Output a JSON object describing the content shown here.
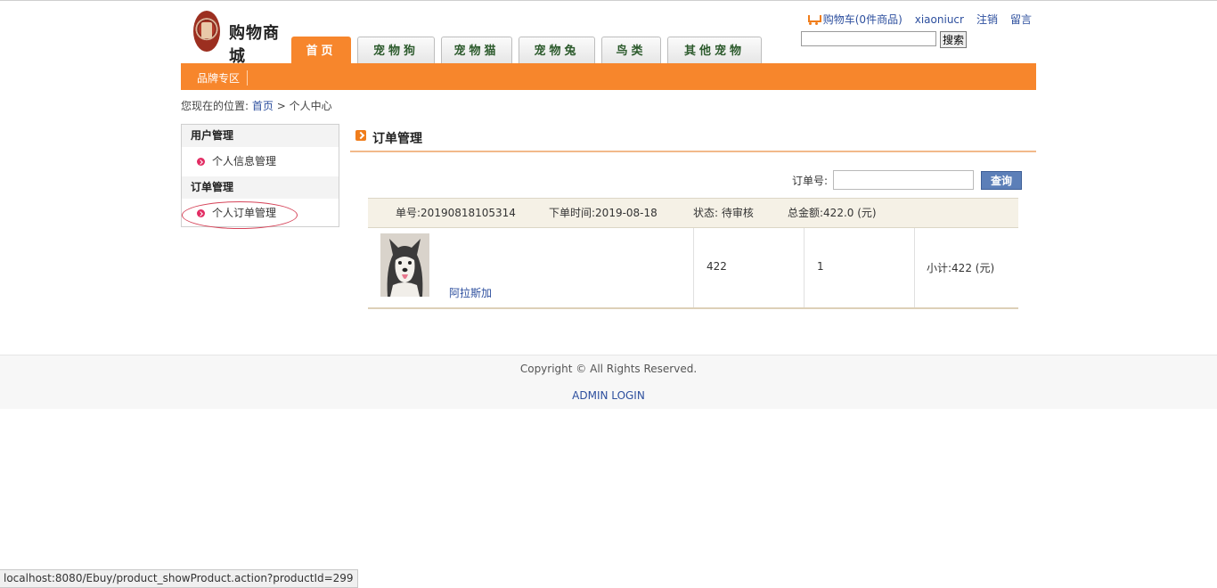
{
  "logo": {
    "text": "购物商城"
  },
  "topbar": {
    "cart": "购物车(0件商品)",
    "username": "xiaoniucr",
    "logout": "注销",
    "message": "留言",
    "search_button": "搜索",
    "search_value": ""
  },
  "nav": {
    "tabs": [
      {
        "label": "首页",
        "active": true
      },
      {
        "label": "宠物狗",
        "active": false
      },
      {
        "label": "宠物猫",
        "active": false
      },
      {
        "label": "宠物兔",
        "active": false
      },
      {
        "label": "鸟类",
        "active": false
      },
      {
        "label": "其他宠物",
        "active": false
      }
    ],
    "brand_zone": "品牌专区"
  },
  "breadcrumb": {
    "prefix": "您现在的位置:",
    "home": "首页",
    "separator": ">",
    "current": "个人中心"
  },
  "sidebar": {
    "user_section": "用户管理",
    "user_item": "个人信息管理",
    "order_section": "订单管理",
    "order_item": "个人订单管理"
  },
  "main": {
    "title": "订单管理",
    "search_label": "订单号:",
    "search_value": "",
    "search_button": "查询",
    "order": {
      "number": "单号:20190818105314",
      "time": "下单时间:2019-08-18",
      "status": "状态: 待审核",
      "total": "总金额:422.0 (元)"
    },
    "item": {
      "name": "阿拉斯加",
      "price": "422",
      "quantity": "1",
      "subtotal": "小计:422 (元)"
    }
  },
  "footer": {
    "copyright": "Copyright © All Rights Reserved.",
    "admin": "ADMIN LOGIN"
  },
  "statusbar": {
    "url": "localhost:8080/Ebuy/product_showProduct.action?productId=299"
  },
  "colors": {
    "accent": "#f7862c",
    "link": "#2d4f9e",
    "query_button": "#5c7fb8"
  }
}
